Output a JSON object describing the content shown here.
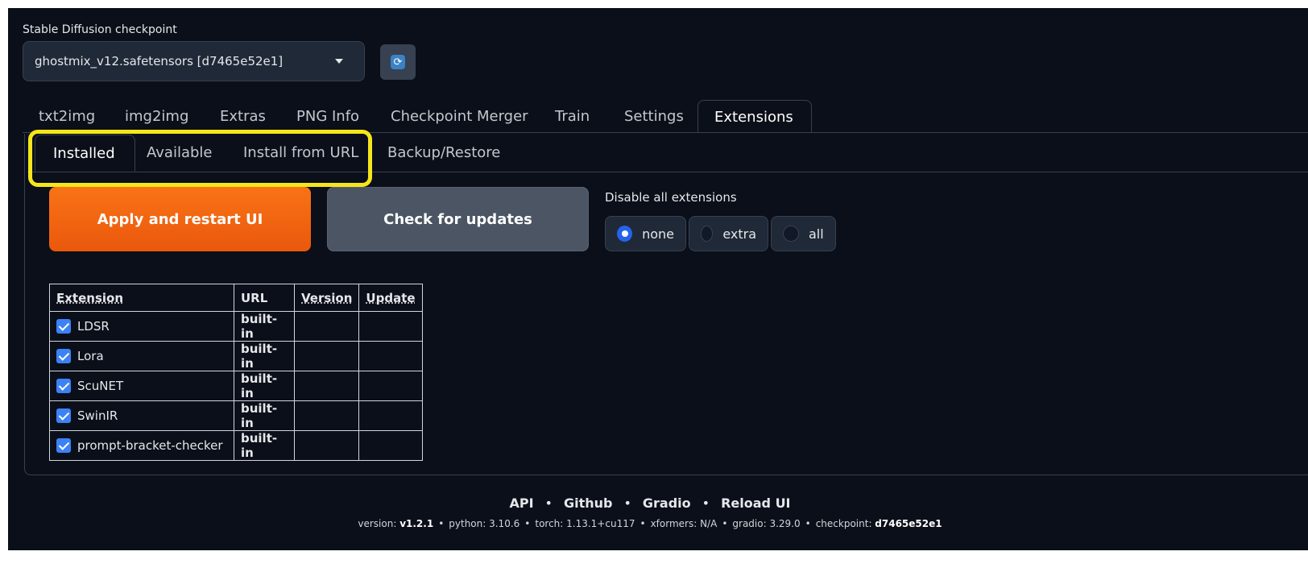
{
  "checkpoint": {
    "label": "Stable Diffusion checkpoint",
    "selected": "ghostmix_v12.safetensors [d7465e52e1]"
  },
  "main_tabs": [
    "txt2img",
    "img2img",
    "Extras",
    "PNG Info",
    "Checkpoint Merger",
    "Train",
    "Settings",
    "Extensions"
  ],
  "main_tab_active": "Extensions",
  "sub_tabs": [
    "Installed",
    "Available",
    "Install from URL",
    "Backup/Restore"
  ],
  "sub_tab_active": "Installed",
  "buttons": {
    "apply": "Apply and restart UI",
    "check": "Check for updates"
  },
  "disable": {
    "label": "Disable all extensions",
    "options": [
      "none",
      "extra",
      "all"
    ],
    "selected": "none"
  },
  "table": {
    "headers": [
      "Extension",
      "URL",
      "Version",
      "Update"
    ],
    "rows": [
      {
        "name": "LDSR",
        "url": "built-in",
        "version": "",
        "update": "",
        "checked": true
      },
      {
        "name": "Lora",
        "url": "built-in",
        "version": "",
        "update": "",
        "checked": true
      },
      {
        "name": "ScuNET",
        "url": "built-in",
        "version": "",
        "update": "",
        "checked": true
      },
      {
        "name": "SwinIR",
        "url": "built-in",
        "version": "",
        "update": "",
        "checked": true
      },
      {
        "name": "prompt-bracket-checker",
        "url": "built-in",
        "version": "",
        "update": "",
        "checked": true
      }
    ]
  },
  "footer": {
    "links": [
      "API",
      "Github",
      "Gradio",
      "Reload UI"
    ],
    "link_separator": "•",
    "meta": [
      {
        "label": "version: ",
        "value": "v1.2.1",
        "bold": true
      },
      {
        "label": "python: ",
        "value": "3.10.6",
        "bold": false
      },
      {
        "label": "torch: ",
        "value": "1.13.1+cu117",
        "bold": false
      },
      {
        "label": "xformers: ",
        "value": "N/A",
        "bold": false
      },
      {
        "label": "gradio: ",
        "value": "3.29.0",
        "bold": false
      },
      {
        "label": "checkpoint: ",
        "value": "d7465e52e1",
        "bold": true
      }
    ]
  },
  "colors": {
    "background": "#0b0f19",
    "accent_orange": "#f97316",
    "highlight": "#f5e61b",
    "checkbox_blue": "#3b82f6"
  }
}
